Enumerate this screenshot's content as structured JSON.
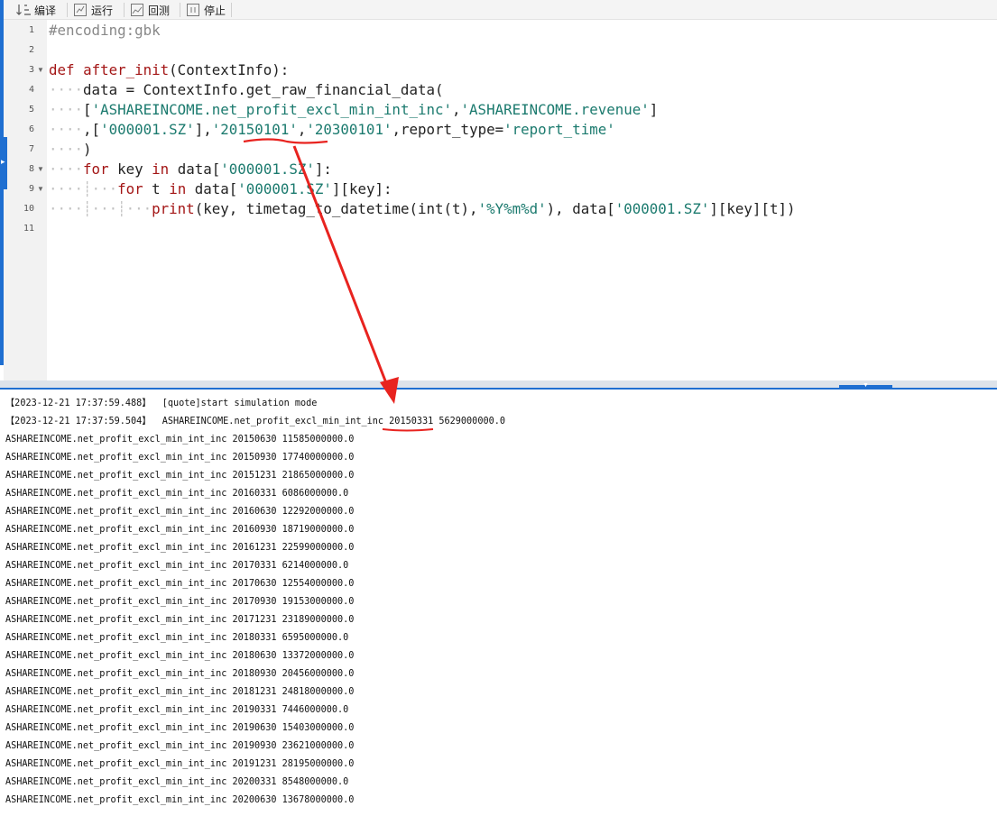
{
  "toolbar": {
    "compile_label": "编译",
    "run_label": "运行",
    "backtest_label": "回测",
    "stop_label": "停止"
  },
  "editor": {
    "line_numbers": [
      "1",
      "2",
      "3",
      "4",
      "5",
      "6",
      "7",
      "8",
      "9",
      "10",
      "11"
    ],
    "lines": {
      "l1": "#encoding:gbk",
      "l3_kw": "def",
      "l3_fn": "after_init",
      "l3_rest": "(ContextInfo):",
      "l4": "data = ContextInfo.get_raw_financial_data(",
      "l5_a": "[",
      "l5_s1": "'ASHAREINCOME.net_profit_excl_min_int_inc'",
      "l5_b": ",",
      "l5_s2": "'ASHAREINCOME.revenue'",
      "l5_c": "]",
      "l6_a": ",[",
      "l6_s1": "'000001.SZ'",
      "l6_b": "],",
      "l6_s2": "'20150101'",
      "l6_c": ",",
      "l6_s3": "'20300101'",
      "l6_d": ",report_type=",
      "l6_s4": "'report_time'",
      "l7": ")",
      "l8_kw1": "for",
      "l8_a": " key ",
      "l8_kw2": "in",
      "l8_b": " data[",
      "l8_s": "'000001.SZ'",
      "l8_c": "]:",
      "l9_kw1": "for",
      "l9_a": " t ",
      "l9_kw2": "in",
      "l9_b": " data[",
      "l9_s": "'000001.SZ'",
      "l9_c": "][key]:",
      "l10_fn": "print",
      "l10_a": "(key, timetag_to_datetime(int(t),",
      "l10_s1": "'%Y%m%d'",
      "l10_b": "), data[",
      "l10_s2": "'000001.SZ'",
      "l10_c": "][key][t])"
    }
  },
  "console": {
    "lines": [
      "【2023-12-21 17:37:59.488】  [quote]start simulation mode",
      "【2023-12-21 17:37:59.504】  ASHAREINCOME.net_profit_excl_min_int_inc 20150331 5629000000.0",
      "ASHAREINCOME.net_profit_excl_min_int_inc 20150630 11585000000.0",
      "ASHAREINCOME.net_profit_excl_min_int_inc 20150930 17740000000.0",
      "ASHAREINCOME.net_profit_excl_min_int_inc 20151231 21865000000.0",
      "ASHAREINCOME.net_profit_excl_min_int_inc 20160331 6086000000.0",
      "ASHAREINCOME.net_profit_excl_min_int_inc 20160630 12292000000.0",
      "ASHAREINCOME.net_profit_excl_min_int_inc 20160930 18719000000.0",
      "ASHAREINCOME.net_profit_excl_min_int_inc 20161231 22599000000.0",
      "ASHAREINCOME.net_profit_excl_min_int_inc 20170331 6214000000.0",
      "ASHAREINCOME.net_profit_excl_min_int_inc 20170630 12554000000.0",
      "ASHAREINCOME.net_profit_excl_min_int_inc 20170930 19153000000.0",
      "ASHAREINCOME.net_profit_excl_min_int_inc 20171231 23189000000.0",
      "ASHAREINCOME.net_profit_excl_min_int_inc 20180331 6595000000.0",
      "ASHAREINCOME.net_profit_excl_min_int_inc 20180630 13372000000.0",
      "ASHAREINCOME.net_profit_excl_min_int_inc 20180930 20456000000.0",
      "ASHAREINCOME.net_profit_excl_min_int_inc 20181231 24818000000.0",
      "ASHAREINCOME.net_profit_excl_min_int_inc 20190331 7446000000.0",
      "ASHAREINCOME.net_profit_excl_min_int_inc 20190630 15403000000.0",
      "ASHAREINCOME.net_profit_excl_min_int_inc 20190930 23621000000.0",
      "ASHAREINCOME.net_profit_excl_min_int_inc 20191231 28195000000.0",
      "ASHAREINCOME.net_profit_excl_min_int_inc 20200331 8548000000.0",
      "ASHAREINCOME.net_profit_excl_min_int_inc 20200630 13678000000.0"
    ]
  },
  "colors": {
    "accent": "#1f6fd1",
    "annotation": "#e8231f",
    "keyword": "#a31515",
    "string": "#1b7a6e"
  },
  "icons": {
    "compile": "sort-icon",
    "run": "run-icon",
    "backtest": "chart-icon",
    "stop": "stop-icon"
  }
}
